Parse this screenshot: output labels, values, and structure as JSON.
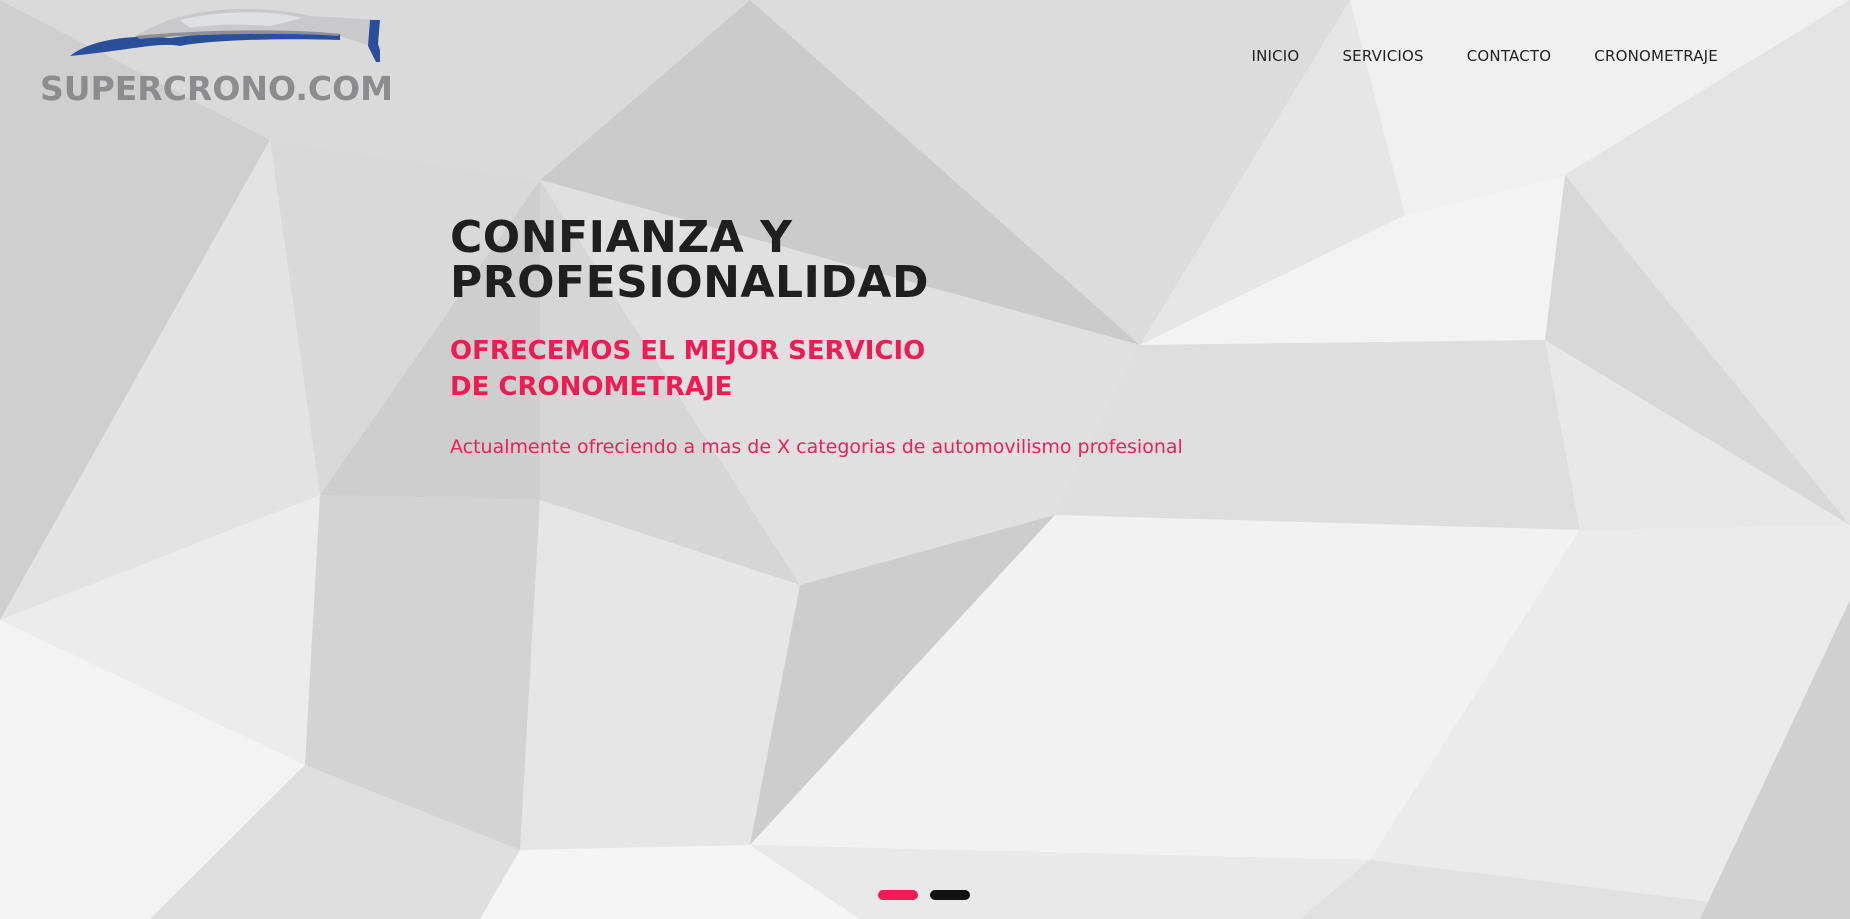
{
  "brand": {
    "logo_text": "SUPERCRONO.COM",
    "text_color": "#8c8c8e",
    "car_accent": "#2a4f9a"
  },
  "nav": {
    "items": [
      {
        "label": "INICIO"
      },
      {
        "label": "SERVICIOS"
      },
      {
        "label": "CONTACTO"
      },
      {
        "label": "CRONOMETRAJE"
      }
    ]
  },
  "hero": {
    "title_line1": "CONFIANZA Y",
    "title_line2": "PROFESIONALIDAD",
    "subtitle_line1": "OFRECEMOS EL MEJOR SERVICIO",
    "subtitle_line2": "DE CRONOMETRAJE",
    "description": "Actualmente ofreciendo a mas de X categorias de automovilismo profesional",
    "accent_color": "#ee1c54"
  },
  "slider": {
    "slide_count": 2,
    "active_index": 0
  }
}
